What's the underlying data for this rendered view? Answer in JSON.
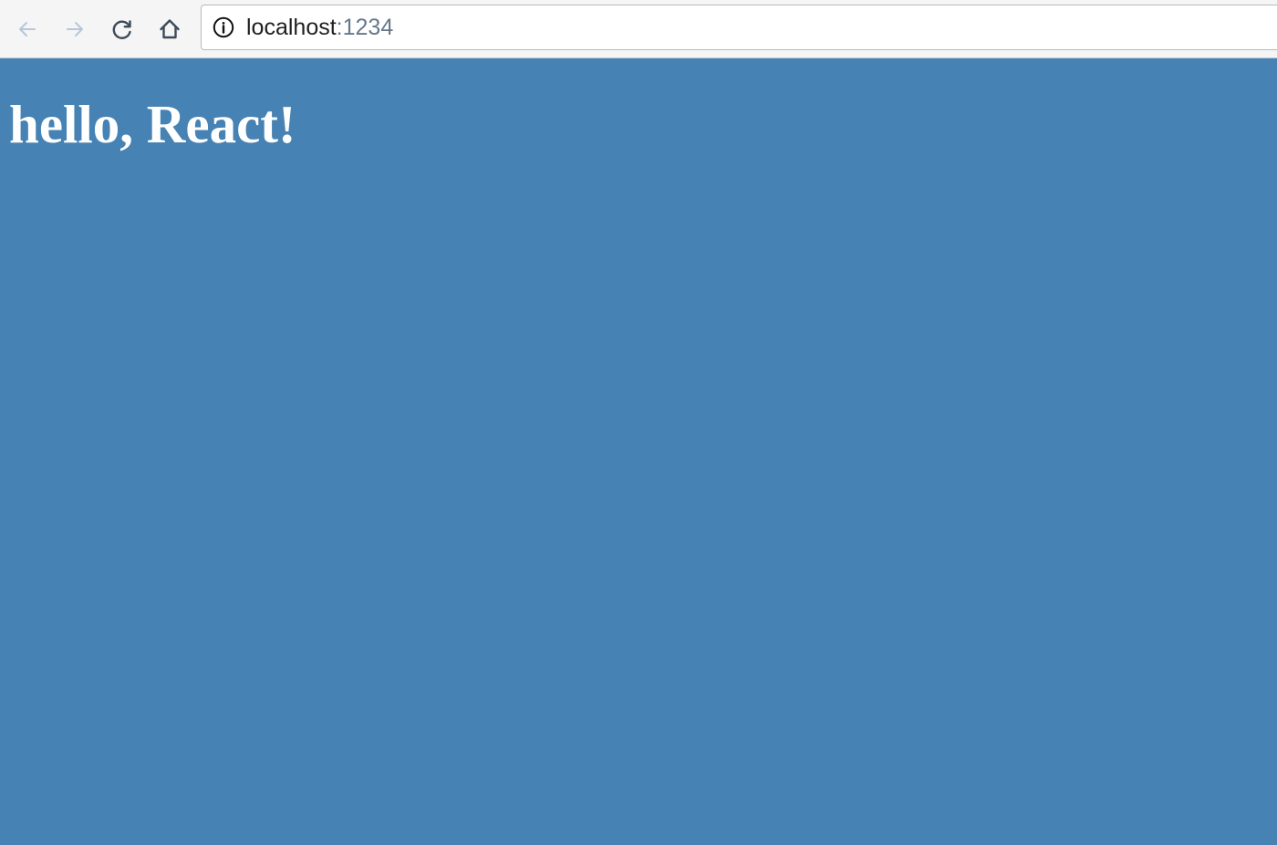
{
  "browser": {
    "toolbar": {
      "back_icon": "arrow-left-icon",
      "forward_icon": "arrow-right-icon",
      "reload_icon": "reload-icon",
      "home_icon": "home-icon",
      "disabled_icon_color": "#b7c7d9",
      "enabled_icon_color": "#3d4a59"
    },
    "address_bar": {
      "security_icon": "info-icon",
      "host": "localhost",
      "port": ":1234",
      "host_color": "#1f1f1f",
      "port_color": "#66788a"
    }
  },
  "page": {
    "background_color": "#4682b4",
    "heading": "hello, React!",
    "heading_color": "#ffffff"
  }
}
